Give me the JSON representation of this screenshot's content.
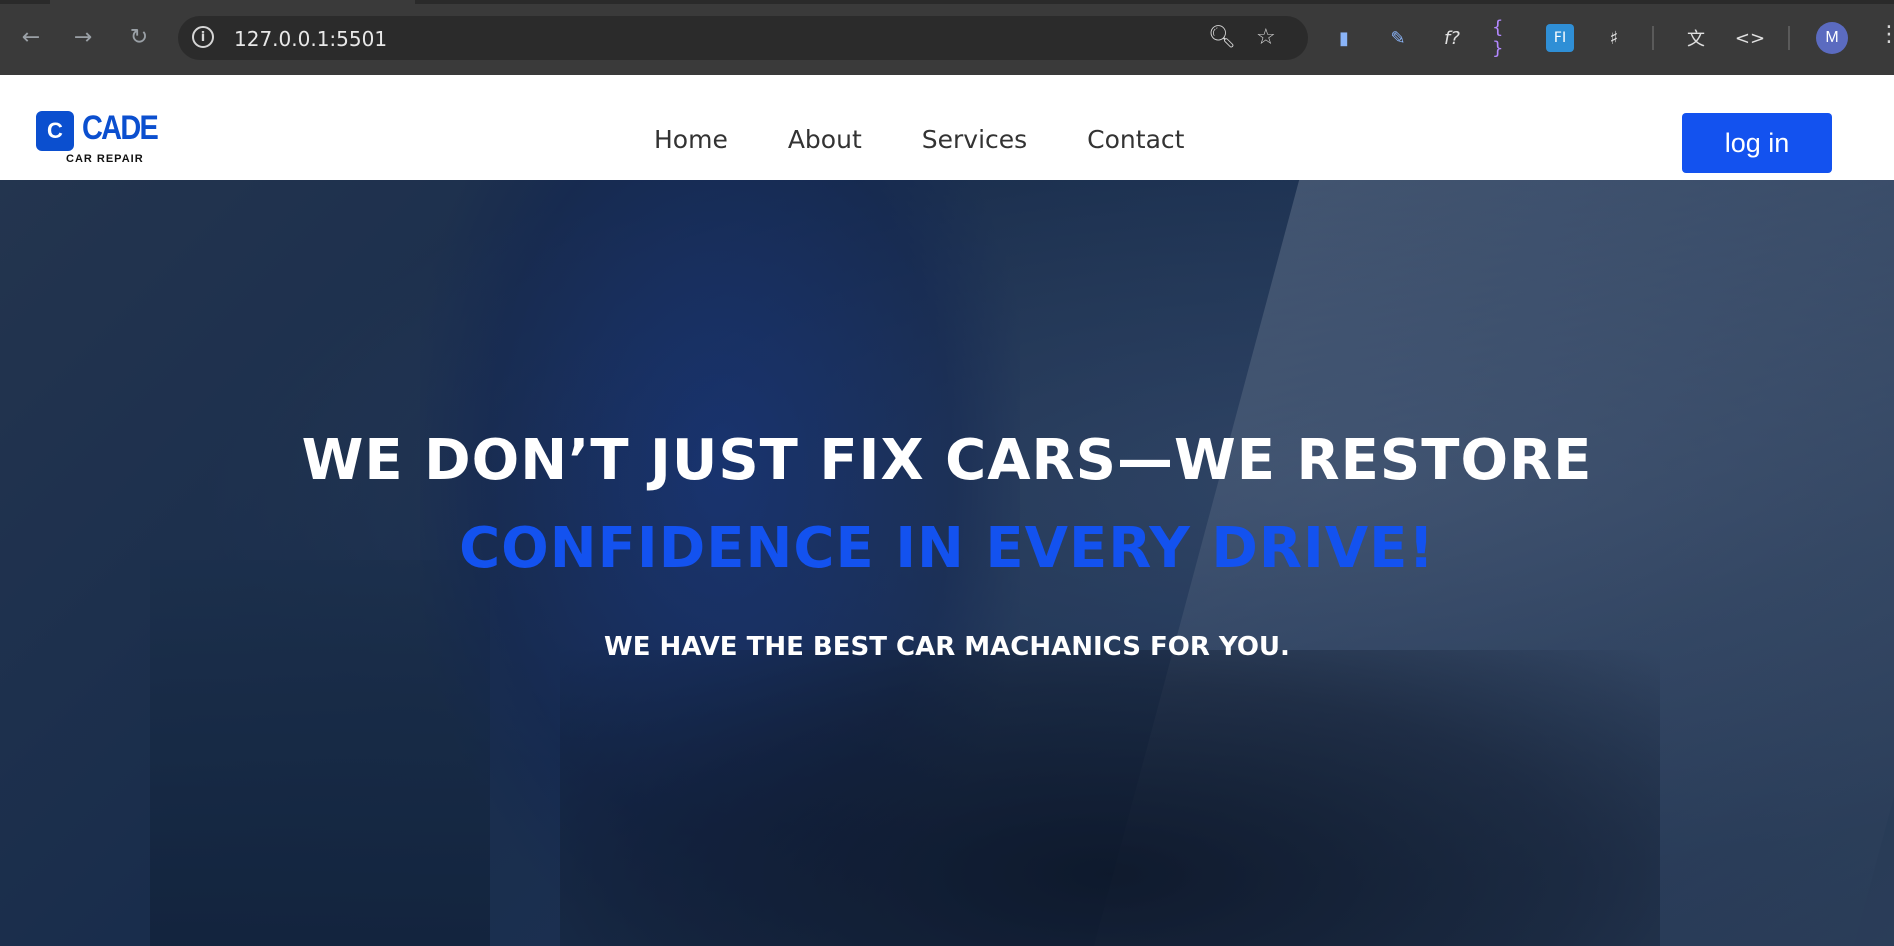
{
  "browser": {
    "url": "127.0.0.1:5501",
    "back_icon": "arrow-left-icon",
    "forward_icon": "arrow-right-icon",
    "reload_icon": "reload-icon",
    "profile_initial": "M"
  },
  "site": {
    "logo_letter": "C",
    "logo_name": "CADE",
    "logo_tagline": "CAR REPAIR",
    "nav": [
      "Home",
      "About",
      "Services",
      "Contact"
    ],
    "login_label": "log in"
  },
  "hero": {
    "headline_line1": "WE DON’T JUST FIX CARS—WE RESTORE",
    "headline_line2": "CONFIDENCE IN EVERY DRIVE!",
    "subheadline": "WE HAVE THE BEST CAR MACHANICS FOR YOU."
  },
  "colors": {
    "accent": "#1352ef",
    "logo_blue": "#0b4fcf"
  }
}
